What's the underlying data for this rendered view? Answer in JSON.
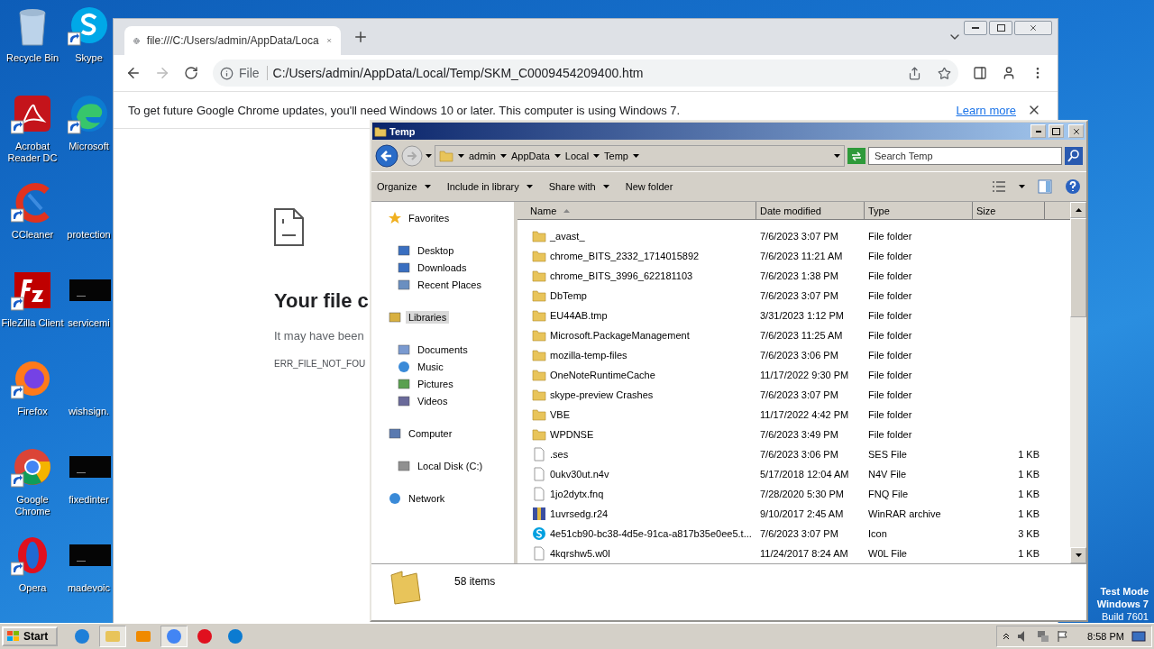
{
  "desktop": {
    "icons": [
      {
        "label": "Recycle Bin",
        "kind": "recycle",
        "shortcut": false
      },
      {
        "label": "Acrobat Reader DC",
        "kind": "acrobat",
        "shortcut": true
      },
      {
        "label": "CCleaner",
        "kind": "ccleaner",
        "shortcut": true
      },
      {
        "label": "FileZilla Client",
        "kind": "filezilla",
        "shortcut": true
      },
      {
        "label": "Firefox",
        "kind": "firefox",
        "shortcut": true
      },
      {
        "label": "Google Chrome",
        "kind": "chrome",
        "shortcut": true
      },
      {
        "label": "Opera",
        "kind": "opera",
        "shortcut": true
      },
      {
        "label": "Skype",
        "kind": "skype",
        "shortcut": true
      },
      {
        "label": "Microsoft",
        "kind": "edge",
        "shortcut": true
      },
      {
        "label": "protection",
        "kind": "blank"
      },
      {
        "label": "servicemi",
        "kind": "dark",
        "shortcut": false
      },
      {
        "label": "wishsign.",
        "kind": "blank"
      },
      {
        "label": "fixedinter",
        "kind": "dark",
        "shortcut": false
      },
      {
        "label": "madevoic",
        "kind": "dark",
        "shortcut": false
      }
    ],
    "test_mode": [
      "Test Mode",
      "Windows 7",
      "Build 7601"
    ]
  },
  "browser": {
    "tab": {
      "title": "file:///C:/Users/admin/AppData/Loca",
      "selected": true
    },
    "forward_disabled": true,
    "address": {
      "scheme": "File",
      "url": "C:/Users/admin/AppData/Local/Temp/SKM_C0009454209400.htm"
    },
    "infobar": {
      "message": "To get future Google Chrome updates, you'll need Windows 10 or later. This computer is using Windows 7.",
      "link": "Learn more"
    },
    "error": {
      "title": "Your file c",
      "message": "It may have been",
      "code": "ERR_FILE_NOT_FOU"
    }
  },
  "explorer": {
    "title": "Temp",
    "breadcrumb": [
      "admin",
      "AppData",
      "Local",
      "Temp"
    ],
    "search": {
      "placeholder": "Search Temp"
    },
    "toolbar": [
      {
        "label": "Organize",
        "menu": true
      },
      {
        "label": "Include in library",
        "menu": true
      },
      {
        "label": "Share with",
        "menu": true
      },
      {
        "label": "New folder",
        "menu": false
      }
    ],
    "nav": [
      {
        "label": "Favorites",
        "kind": "favorites",
        "selected": false,
        "children": [
          {
            "label": "Desktop",
            "kind": "desktop",
            "selected": false
          },
          {
            "label": "Downloads",
            "kind": "downloads",
            "selected": false
          },
          {
            "label": "Recent Places",
            "kind": "recent",
            "selected": false
          }
        ]
      },
      {
        "label": "Libraries",
        "kind": "libraries",
        "selected": true,
        "children": [
          {
            "label": "Documents",
            "kind": "documents",
            "selected": false
          },
          {
            "label": "Music",
            "kind": "music",
            "selected": false
          },
          {
            "label": "Pictures",
            "kind": "pictures",
            "selected": false
          },
          {
            "label": "Videos",
            "kind": "videos",
            "selected": false
          }
        ]
      },
      {
        "label": "Computer",
        "kind": "computer",
        "selected": false,
        "children": [
          {
            "label": "Local Disk (C:)",
            "kind": "disk",
            "selected": false
          }
        ]
      },
      {
        "label": "Network",
        "kind": "network",
        "selected": false
      }
    ],
    "columns": [
      {
        "label": "Name",
        "sorted": true
      },
      {
        "label": "Date modified",
        "sorted": false
      },
      {
        "label": "Type",
        "sorted": false
      },
      {
        "label": "Size",
        "sorted": false
      }
    ],
    "rows": [
      {
        "name": "_avast_",
        "date": "7/6/2023 3:07 PM",
        "type": "File folder",
        "kind": "folder"
      },
      {
        "name": "chrome_BITS_2332_1714015892",
        "date": "7/6/2023 11:21 AM",
        "type": "File folder",
        "kind": "folder"
      },
      {
        "name": "chrome_BITS_3996_622181103",
        "date": "7/6/2023 1:38 PM",
        "type": "File folder",
        "kind": "folder"
      },
      {
        "name": "DbTemp",
        "date": "7/6/2023 3:07 PM",
        "type": "File folder",
        "kind": "folder"
      },
      {
        "name": "EU44AB.tmp",
        "date": "3/31/2023 1:12 PM",
        "type": "File folder",
        "kind": "folder"
      },
      {
        "name": "Microsoft.PackageManagement",
        "date": "7/6/2023 11:25 AM",
        "type": "File folder",
        "kind": "folder"
      },
      {
        "name": "mozilla-temp-files",
        "date": "7/6/2023 3:06 PM",
        "type": "File folder",
        "kind": "folder"
      },
      {
        "name": "OneNoteRuntimeCache",
        "date": "11/17/2022 9:30 PM",
        "type": "File folder",
        "kind": "folder"
      },
      {
        "name": "skype-preview Crashes",
        "date": "7/6/2023 3:07 PM",
        "type": "File folder",
        "kind": "folder"
      },
      {
        "name": "VBE",
        "date": "11/17/2022 4:42 PM",
        "type": "File folder",
        "kind": "folder"
      },
      {
        "name": "WPDNSE",
        "date": "7/6/2023 3:49 PM",
        "type": "File folder",
        "kind": "folder"
      },
      {
        "name": ".ses",
        "date": "7/6/2023 3:06 PM",
        "type": "SES File",
        "size": "1 KB",
        "kind": "file"
      },
      {
        "name": "0ukv30ut.n4v",
        "date": "5/17/2018 12:04 AM",
        "type": "N4V File",
        "size": "1 KB",
        "kind": "file"
      },
      {
        "name": "1jo2dytx.fnq",
        "date": "7/28/2020 5:30 PM",
        "type": "FNQ File",
        "size": "1 KB",
        "kind": "file"
      },
      {
        "name": "1uvrsedg.r24",
        "date": "9/10/2017 2:45 AM",
        "type": "WinRAR archive",
        "size": "1 KB",
        "kind": "archive"
      },
      {
        "name": "4e51cb90-bc38-4d5e-91ca-a817b35e0ee5.t...",
        "date": "7/6/2023 3:07 PM",
        "type": "Icon",
        "size": "3 KB",
        "kind": "skype"
      },
      {
        "name": "4kqrshw5.w0l",
        "date": "11/24/2017 8:24 AM",
        "type": "W0L File",
        "size": "1 KB",
        "kind": "file"
      }
    ],
    "status": "58 items"
  },
  "taskbar": {
    "start": "Start",
    "apps": [
      {
        "kind": "ie",
        "active": false
      },
      {
        "kind": "explorer",
        "active": true
      },
      {
        "kind": "media",
        "active": false
      },
      {
        "kind": "chrome",
        "active": true
      },
      {
        "kind": "opera",
        "active": false
      },
      {
        "kind": "edge",
        "active": false
      }
    ],
    "clock": "8:58 PM"
  }
}
